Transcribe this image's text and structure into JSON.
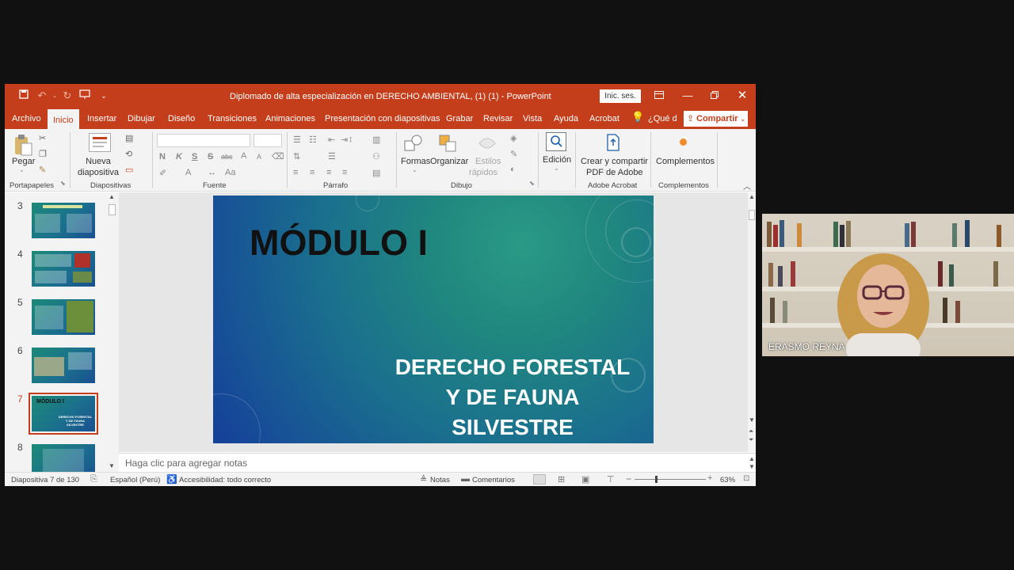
{
  "window": {
    "title": "Diplomado de alta especialización en DERECHO AMBIENTAL, (1) (1)  -  PowerPoint",
    "sign_in": "Inic. ses.",
    "accent": "#c43e1c"
  },
  "tabs": [
    "Archivo",
    "Inicio",
    "Insertar",
    "Dibujar",
    "Diseño",
    "Transiciones",
    "Animaciones",
    "Presentación con diapositivas",
    "Grabar",
    "Revisar",
    "Vista",
    "Ayuda",
    "Acrobat"
  ],
  "active_tab": "Inicio",
  "tell_me": "¿Qué d",
  "share_label": "Compartir",
  "ribbon": {
    "paste": "Pegar",
    "new_slide_1": "Nueva",
    "new_slide_2": "diapositiva",
    "bold": "N",
    "italic": "K",
    "underline": "S",
    "strike": "S",
    "spacing": "abc",
    "font_color": "A",
    "font_size_up": "A",
    "font_size_down": "A",
    "case": "Aa",
    "shapes": "Formas",
    "arrange": "Organizar",
    "quick_styles_1": "Estilos",
    "quick_styles_2": "rápidos",
    "editing": "Edición",
    "adobe_1": "Crear y compartir",
    "adobe_2": "PDF de Adobe",
    "addins": "Complementos",
    "groups": {
      "clipboard": "Portapapeles",
      "slides": "Diapositivas",
      "font": "Fuente",
      "paragraph": "Párrafo",
      "drawing": "Dibujo",
      "adobe": "Adobe Acrobat",
      "addins": "Complementos"
    }
  },
  "thumbnails": [
    {
      "num": "3"
    },
    {
      "num": "4"
    },
    {
      "num": "5"
    },
    {
      "num": "6"
    },
    {
      "num": "7"
    },
    {
      "num": "8"
    }
  ],
  "thumb7": {
    "title": "MÓDULO I",
    "sub1": "DERECHO FORESTAL",
    "sub2": "Y DE FAUNA",
    "sub3": "SILVESTRE"
  },
  "slide": {
    "title": "MÓDULO I",
    "line1": "DERECHO FORESTAL",
    "line2": "Y DE FAUNA",
    "line3": "SILVESTRE"
  },
  "notes_placeholder": "Haga clic para agregar notas",
  "status": {
    "slide_count": "Diapositiva 7 de 130",
    "language": "Español (Perú)",
    "accessibility": "Accesibilidad: todo correcto",
    "notes": "Notas",
    "comments": "Comentarios",
    "zoom": "63%"
  },
  "video": {
    "participant": "ERASMO REYNA"
  }
}
